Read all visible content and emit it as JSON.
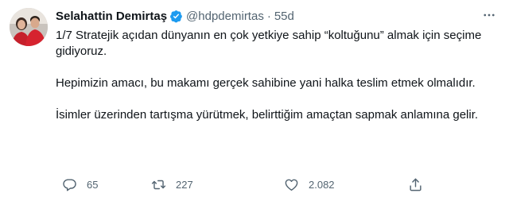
{
  "tweet": {
    "author": {
      "display_name": "Selahattin Demirtaş",
      "handle": "@hdpdemirtas",
      "separator": "·",
      "time": "55d",
      "verified_icon": "verified-badge-icon",
      "avatar": "avatar-photo"
    },
    "paragraphs": [
      "1/7 Stratejik açıdan dünyanın en çok yetkiye sahip “koltuğunu” almak için seçime gidiyoruz.",
      "Hepimizin amacı, bu makamı gerçek sahibine yani halka teslim etmek olmalıdır.",
      "İsimler üzerinden tartışma yürütmek, belirttiğim amaçtan sapmak anlamına gelir."
    ],
    "actions": {
      "reply_count": "65",
      "retweet_count": "227",
      "like_count": "2.082"
    },
    "colors": {
      "verified": "#1d9bf0",
      "muted": "#536471",
      "text": "#0f1419"
    }
  }
}
